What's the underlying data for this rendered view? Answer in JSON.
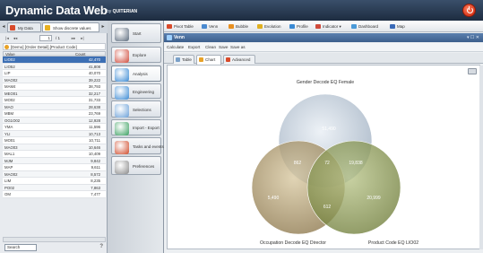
{
  "app": {
    "title": "Dynamic Data Web",
    "by_prefix": "by",
    "by_brand": "QUITERIAN"
  },
  "left": {
    "tabs": [
      {
        "label": "My Data",
        "color": "#d84a2a"
      },
      {
        "label": "Show discrete values",
        "color": "#e8b020"
      }
    ],
    "pager": {
      "page": "1",
      "total": "/ 1"
    },
    "breadcrumb": "[Demo] [Order Detail].[Product Code]",
    "grid_headers": {
      "value": "Value",
      "count": "Count"
    },
    "rows": [
      {
        "value": "LIO02",
        "count": "42,470",
        "selected": true
      },
      {
        "value": "LIO52",
        "count": "41,808"
      },
      {
        "value": "LIP",
        "count": "40,070"
      },
      {
        "value": "MAO02",
        "count": "39,222"
      },
      {
        "value": "MAM4",
        "count": "38,793"
      },
      {
        "value": "MEO01",
        "count": "32,217"
      },
      {
        "value": "MO02",
        "count": "31,733"
      },
      {
        "value": "MAO",
        "count": "28,638"
      },
      {
        "value": "MBM",
        "count": "23,769"
      },
      {
        "value": "OG1O02",
        "count": "12,928"
      },
      {
        "value": "YMA",
        "count": "11,596"
      },
      {
        "value": "YLI",
        "count": "10,713"
      },
      {
        "value": "MO01",
        "count": "10,711"
      },
      {
        "value": "MAO03",
        "count": "10,646"
      },
      {
        "value": "MAL1",
        "count": "10,409"
      },
      {
        "value": "MJM",
        "count": "9,842"
      },
      {
        "value": "MAP",
        "count": "9,611"
      },
      {
        "value": "MAO02",
        "count": "8,572"
      },
      {
        "value": "LIM",
        "count": "8,235"
      },
      {
        "value": "PO02",
        "count": "7,863"
      },
      {
        "value": "OM",
        "count": "7,477"
      }
    ],
    "search_label": "Search",
    "help": "?"
  },
  "nav": [
    {
      "label": "Start",
      "icon": "start-icon",
      "color": "#5b6a7c"
    },
    {
      "label": "Explore",
      "icon": "explore-icon",
      "color": "#d04a3a"
    },
    {
      "label": "Analysis",
      "icon": "analysis-icon",
      "color": "#3a8ad4",
      "active": true
    },
    {
      "label": "Engineering",
      "icon": "engineering-icon",
      "color": "#3a8ad4"
    },
    {
      "label": "Selections",
      "icon": "selections-icon",
      "color": "#6aa0d8"
    },
    {
      "label": "Import - Export",
      "icon": "import-export-icon",
      "color": "#3aa060"
    },
    {
      "label": "Tasks and events",
      "icon": "tasks-icon",
      "color": "#d04a2a"
    },
    {
      "label": "Preferences",
      "icon": "preferences-icon",
      "color": "#8a8a8a"
    }
  ],
  "toolbar": [
    {
      "label": "Pivot Table",
      "color": "#d84a2a"
    },
    {
      "label": "Venn",
      "color": "#4a8ad0"
    },
    {
      "label": "Bubble",
      "color": "#e89020"
    },
    {
      "label": "Evolution",
      "color": "#e0b020"
    },
    {
      "label": "Profile",
      "color": "#3a8ad4"
    },
    {
      "label": "Indicator ▾",
      "color": "#d04a3a"
    },
    {
      "label": "Dashboard",
      "color": "#4a9ad8"
    },
    {
      "label": "Map",
      "color": "#3a6ab8"
    }
  ],
  "view": {
    "title": "Venn",
    "controls": "▾ ☐ ✕"
  },
  "menu": [
    "Calculate",
    "Export",
    "Clean",
    "Save",
    "Save as"
  ],
  "subtabs": [
    {
      "label": "Table",
      "color": "#7aa0c8"
    },
    {
      "label": "Chart",
      "color": "#e8a227",
      "active": true
    },
    {
      "label": "Advanced",
      "color": "#d84a2a"
    }
  ],
  "chart_data": {
    "type": "venn",
    "sets": [
      {
        "name": "Gender Decode EQ  Female",
        "color": "#b8c8d8"
      },
      {
        "name": "Occupation Decode EQ  Director",
        "color": "#a89060"
      },
      {
        "name": "Product Code EQ  LIO02",
        "color": "#8a9a4a"
      }
    ],
    "regions": [
      {
        "sets": [
          "A"
        ],
        "value": "51,490"
      },
      {
        "sets": [
          "B"
        ],
        "value": "5,490"
      },
      {
        "sets": [
          "C"
        ],
        "value": "20,999"
      },
      {
        "sets": [
          "A",
          "B"
        ],
        "value": "862"
      },
      {
        "sets": [
          "A",
          "C"
        ],
        "value": "19,838"
      },
      {
        "sets": [
          "B",
          "C"
        ],
        "value": "612"
      },
      {
        "sets": [
          "A",
          "B",
          "C"
        ],
        "value": "72"
      }
    ]
  }
}
